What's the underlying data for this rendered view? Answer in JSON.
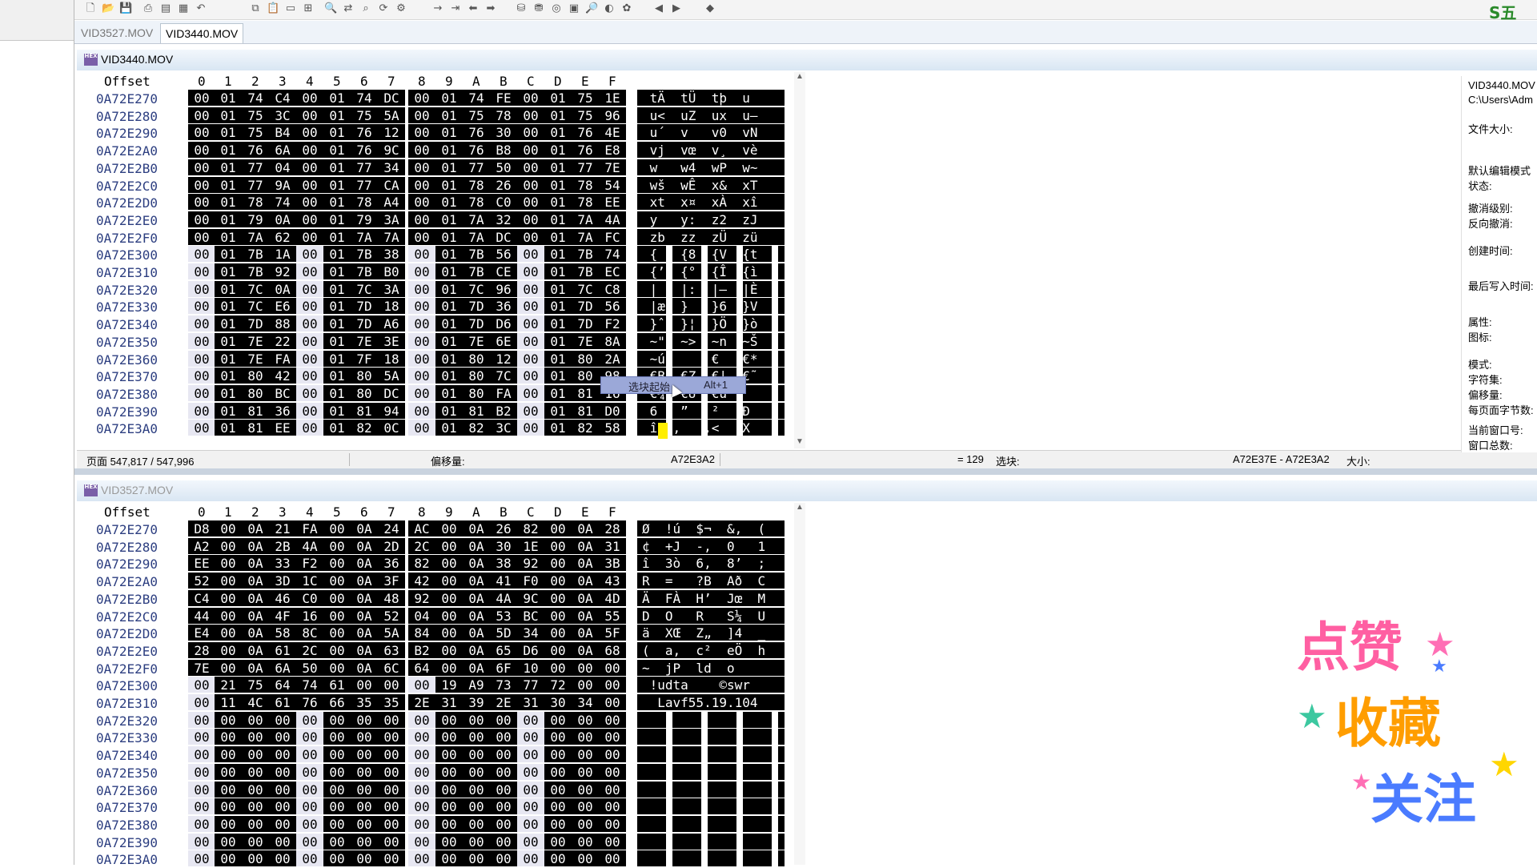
{
  "tabs": [
    "VID3527.MOV",
    "VID3440.MOV"
  ],
  "hex_header": {
    "offset_label": "Offset",
    "columns": [
      "0",
      "1",
      "2",
      "3",
      "4",
      "5",
      "6",
      "7",
      "8",
      "9",
      "A",
      "B",
      "C",
      "D",
      "E",
      "F"
    ]
  },
  "top_pane": {
    "title": "VID3440.MOV",
    "rows": [
      {
        "offset": "0A72E270",
        "bytes": [
          "00",
          "01",
          "74",
          "C4",
          "00",
          "01",
          "74",
          "DC",
          "00",
          "01",
          "74",
          "FE",
          "00",
          "01",
          "75",
          "1E"
        ],
        "ascii": " tÄ  tÜ  tþ  u"
      },
      {
        "offset": "0A72E280",
        "bytes": [
          "00",
          "01",
          "75",
          "3C",
          "00",
          "01",
          "75",
          "5A",
          "00",
          "01",
          "75",
          "78",
          "00",
          "01",
          "75",
          "96"
        ],
        "ascii": " u<  uZ  ux  u–"
      },
      {
        "offset": "0A72E290",
        "bytes": [
          "00",
          "01",
          "75",
          "B4",
          "00",
          "01",
          "76",
          "12",
          "00",
          "01",
          "76",
          "30",
          "00",
          "01",
          "76",
          "4E"
        ],
        "ascii": " u´  v   v0  vN"
      },
      {
        "offset": "0A72E2A0",
        "bytes": [
          "00",
          "01",
          "76",
          "6A",
          "00",
          "01",
          "76",
          "9C",
          "00",
          "01",
          "76",
          "B8",
          "00",
          "01",
          "76",
          "E8"
        ],
        "ascii": " vj  vœ  v¸  vè"
      },
      {
        "offset": "0A72E2B0",
        "bytes": [
          "00",
          "01",
          "77",
          "04",
          "00",
          "01",
          "77",
          "34",
          "00",
          "01",
          "77",
          "50",
          "00",
          "01",
          "77",
          "7E"
        ],
        "ascii": " w   w4  wP  w~"
      },
      {
        "offset": "0A72E2C0",
        "bytes": [
          "00",
          "01",
          "77",
          "9A",
          "00",
          "01",
          "77",
          "CA",
          "00",
          "01",
          "78",
          "26",
          "00",
          "01",
          "78",
          "54"
        ],
        "ascii": " wš  wÊ  x&  xT"
      },
      {
        "offset": "0A72E2D0",
        "bytes": [
          "00",
          "01",
          "78",
          "74",
          "00",
          "01",
          "78",
          "A4",
          "00",
          "01",
          "78",
          "C0",
          "00",
          "01",
          "78",
          "EE"
        ],
        "ascii": " xt  x¤  xÀ  xî"
      },
      {
        "offset": "0A72E2E0",
        "bytes": [
          "00",
          "01",
          "79",
          "0A",
          "00",
          "01",
          "79",
          "3A",
          "00",
          "01",
          "7A",
          "32",
          "00",
          "01",
          "7A",
          "4A"
        ],
        "ascii": " y   y:  z2  zJ"
      },
      {
        "offset": "0A72E2F0",
        "bytes": [
          "00",
          "01",
          "7A",
          "62",
          "00",
          "01",
          "7A",
          "7A",
          "00",
          "01",
          "7A",
          "DC",
          "00",
          "01",
          "7A",
          "FC"
        ],
        "ascii": " zb  zz  zÜ  zü"
      },
      {
        "offset": "0A72E300",
        "bytes": [
          "00",
          "01",
          "7B",
          "1A",
          "00",
          "01",
          "7B",
          "38",
          "00",
          "01",
          "7B",
          "56",
          "00",
          "01",
          "7B",
          "74"
        ],
        "ascii": " {   {8  {V  {t"
      },
      {
        "offset": "0A72E310",
        "bytes": [
          "00",
          "01",
          "7B",
          "92",
          "00",
          "01",
          "7B",
          "B0",
          "00",
          "01",
          "7B",
          "CE",
          "00",
          "01",
          "7B",
          "EC"
        ],
        "ascii": " {’  {°  {Î  {ì"
      },
      {
        "offset": "0A72E320",
        "bytes": [
          "00",
          "01",
          "7C",
          "0A",
          "00",
          "01",
          "7C",
          "3A",
          "00",
          "01",
          "7C",
          "96",
          "00",
          "01",
          "7C",
          "C8"
        ],
        "ascii": " |   |:  |–  |È"
      },
      {
        "offset": "0A72E330",
        "bytes": [
          "00",
          "01",
          "7C",
          "E6",
          "00",
          "01",
          "7D",
          "18",
          "00",
          "01",
          "7D",
          "36",
          "00",
          "01",
          "7D",
          "56"
        ],
        "ascii": " |æ  }   }6  }V"
      },
      {
        "offset": "0A72E340",
        "bytes": [
          "00",
          "01",
          "7D",
          "88",
          "00",
          "01",
          "7D",
          "A6",
          "00",
          "01",
          "7D",
          "D6",
          "00",
          "01",
          "7D",
          "F2"
        ],
        "ascii": " }ˆ  }¦  }Ö  }ò"
      },
      {
        "offset": "0A72E350",
        "bytes": [
          "00",
          "01",
          "7E",
          "22",
          "00",
          "01",
          "7E",
          "3E",
          "00",
          "01",
          "7E",
          "6E",
          "00",
          "01",
          "7E",
          "8A"
        ],
        "ascii": " ~\"  ~>  ~n  ~Š"
      },
      {
        "offset": "0A72E360",
        "bytes": [
          "00",
          "01",
          "7E",
          "FA",
          "00",
          "01",
          "7F",
          "18",
          "00",
          "01",
          "80",
          "12",
          "00",
          "01",
          "80",
          "2A"
        ],
        "ascii": " ~ú      €   €*"
      },
      {
        "offset": "0A72E370",
        "bytes": [
          "00",
          "01",
          "80",
          "42",
          "00",
          "01",
          "80",
          "5A",
          "00",
          "01",
          "80",
          "7C",
          "00",
          "01",
          "80",
          "98"
        ],
        "ascii": " €B  €Z  €|  €˜"
      },
      {
        "offset": "0A72E380",
        "bytes": [
          "00",
          "01",
          "80",
          "BC",
          "00",
          "01",
          "80",
          "DC",
          "00",
          "01",
          "80",
          "FA",
          "00",
          "01",
          "81",
          "16"
        ],
        "ascii": " €¼  €Ü  €ú    "
      },
      {
        "offset": "0A72E390",
        "bytes": [
          "00",
          "01",
          "81",
          "36",
          "00",
          "01",
          "81",
          "94",
          "00",
          "01",
          "81",
          "B2",
          "00",
          "01",
          "81",
          "D0"
        ],
        "ascii": " 6   ”   ²   Ð"
      },
      {
        "offset": "0A72E3A0",
        "bytes": [
          "00",
          "01",
          "81",
          "EE",
          "00",
          "01",
          "82",
          "0C",
          "00",
          "01",
          "82",
          "3C",
          "00",
          "01",
          "82",
          "58"
        ],
        "ascii": " î  ‚   ‚<  ‚X"
      }
    ]
  },
  "status_bar": {
    "page": "页面 547,817 / 547,996",
    "offset_label": "偏移量:",
    "offset_value": "A72E3A2",
    "eq": "= 129",
    "selection_label": "选块:",
    "selection_value": "A72E37E - A72E3A2",
    "size_label": "大小:"
  },
  "context_popup": {
    "label": "选块起始",
    "shortcut": "Alt+1"
  },
  "bottom_pane": {
    "title": "VID3527.MOV",
    "rows": [
      {
        "offset": "0A72E270",
        "bytes": [
          "D8",
          "00",
          "0A",
          "21",
          "FA",
          "00",
          "0A",
          "24",
          "AC",
          "00",
          "0A",
          "26",
          "82",
          "00",
          "0A",
          "28"
        ],
        "ascii": "Ø  !ú  $¬  &‚  ("
      },
      {
        "offset": "0A72E280",
        "bytes": [
          "A2",
          "00",
          "0A",
          "2B",
          "4A",
          "00",
          "0A",
          "2D",
          "2C",
          "00",
          "0A",
          "30",
          "1E",
          "00",
          "0A",
          "31"
        ],
        "ascii": "¢  +J  -,  0   1"
      },
      {
        "offset": "0A72E290",
        "bytes": [
          "EE",
          "00",
          "0A",
          "33",
          "F2",
          "00",
          "0A",
          "36",
          "82",
          "00",
          "0A",
          "38",
          "92",
          "00",
          "0A",
          "3B"
        ],
        "ascii": "î  3ò  6‚  8’  ;"
      },
      {
        "offset": "0A72E2A0",
        "bytes": [
          "52",
          "00",
          "0A",
          "3D",
          "1C",
          "00",
          "0A",
          "3F",
          "42",
          "00",
          "0A",
          "41",
          "F0",
          "00",
          "0A",
          "43"
        ],
        "ascii": "R  =   ?B  Að  C"
      },
      {
        "offset": "0A72E2B0",
        "bytes": [
          "C4",
          "00",
          "0A",
          "46",
          "C0",
          "00",
          "0A",
          "48",
          "92",
          "00",
          "0A",
          "4A",
          "9C",
          "00",
          "0A",
          "4D"
        ],
        "ascii": "Ä  FÀ  H’  Jœ  M"
      },
      {
        "offset": "0A72E2C0",
        "bytes": [
          "44",
          "00",
          "0A",
          "4F",
          "16",
          "00",
          "0A",
          "52",
          "04",
          "00",
          "0A",
          "53",
          "BC",
          "00",
          "0A",
          "55"
        ],
        "ascii": "D  O   R   S¼  U"
      },
      {
        "offset": "0A72E2D0",
        "bytes": [
          "E4",
          "00",
          "0A",
          "58",
          "8C",
          "00",
          "0A",
          "5A",
          "84",
          "00",
          "0A",
          "5D",
          "34",
          "00",
          "0A",
          "5F"
        ],
        "ascii": "ä  XŒ  Z„  ]4  _"
      },
      {
        "offset": "0A72E2E0",
        "bytes": [
          "28",
          "00",
          "0A",
          "61",
          "2C",
          "00",
          "0A",
          "63",
          "B2",
          "00",
          "0A",
          "65",
          "D6",
          "00",
          "0A",
          "68"
        ],
        "ascii": "(  a,  c²  eÖ  h"
      },
      {
        "offset": "0A72E2F0",
        "bytes": [
          "7E",
          "00",
          "0A",
          "6A",
          "50",
          "00",
          "0A",
          "6C",
          "64",
          "00",
          "0A",
          "6F",
          "10",
          "00",
          "00",
          "00"
        ],
        "ascii": "~  jP  ld  o    "
      },
      {
        "offset": "0A72E300",
        "bytes": [
          "00",
          "21",
          "75",
          "64",
          "74",
          "61",
          "00",
          "00",
          "00",
          "19",
          "A9",
          "73",
          "77",
          "72",
          "00",
          "00"
        ],
        "ascii": " !udta    ©swr  "
      },
      {
        "offset": "0A72E310",
        "bytes": [
          "00",
          "11",
          "4C",
          "61",
          "76",
          "66",
          "35",
          "35",
          "2E",
          "31",
          "39",
          "2E",
          "31",
          "30",
          "34",
          "00"
        ],
        "ascii": "  Lavf55.19.104 "
      },
      {
        "offset": "0A72E320",
        "bytes": [
          "00",
          "00",
          "00",
          "00",
          "00",
          "00",
          "00",
          "00",
          "00",
          "00",
          "00",
          "00",
          "00",
          "00",
          "00",
          "00"
        ],
        "ascii": ""
      },
      {
        "offset": "0A72E330",
        "bytes": [
          "00",
          "00",
          "00",
          "00",
          "00",
          "00",
          "00",
          "00",
          "00",
          "00",
          "00",
          "00",
          "00",
          "00",
          "00",
          "00"
        ],
        "ascii": ""
      },
      {
        "offset": "0A72E340",
        "bytes": [
          "00",
          "00",
          "00",
          "00",
          "00",
          "00",
          "00",
          "00",
          "00",
          "00",
          "00",
          "00",
          "00",
          "00",
          "00",
          "00"
        ],
        "ascii": ""
      },
      {
        "offset": "0A72E350",
        "bytes": [
          "00",
          "00",
          "00",
          "00",
          "00",
          "00",
          "00",
          "00",
          "00",
          "00",
          "00",
          "00",
          "00",
          "00",
          "00",
          "00"
        ],
        "ascii": ""
      },
      {
        "offset": "0A72E360",
        "bytes": [
          "00",
          "00",
          "00",
          "00",
          "00",
          "00",
          "00",
          "00",
          "00",
          "00",
          "00",
          "00",
          "00",
          "00",
          "00",
          "00"
        ],
        "ascii": ""
      },
      {
        "offset": "0A72E370",
        "bytes": [
          "00",
          "00",
          "00",
          "00",
          "00",
          "00",
          "00",
          "00",
          "00",
          "00",
          "00",
          "00",
          "00",
          "00",
          "00",
          "00"
        ],
        "ascii": ""
      },
      {
        "offset": "0A72E380",
        "bytes": [
          "00",
          "00",
          "00",
          "00",
          "00",
          "00",
          "00",
          "00",
          "00",
          "00",
          "00",
          "00",
          "00",
          "00",
          "00",
          "00"
        ],
        "ascii": ""
      },
      {
        "offset": "0A72E390",
        "bytes": [
          "00",
          "00",
          "00",
          "00",
          "00",
          "00",
          "00",
          "00",
          "00",
          "00",
          "00",
          "00",
          "00",
          "00",
          "00",
          "00"
        ],
        "ascii": ""
      },
      {
        "offset": "0A72E3A0",
        "bytes": [
          "00",
          "00",
          "00",
          "00",
          "00",
          "00",
          "00",
          "00",
          "00",
          "00",
          "00",
          "00",
          "00",
          "00",
          "00",
          "00"
        ],
        "ascii": ""
      }
    ]
  },
  "info_panel": {
    "filename": "VID3440.MOV",
    "path": "C:\\Users\\Adm",
    "file_size_label": "文件大小:",
    "default_edit_mode": "默认编辑模式",
    "state": "状态:",
    "undo_level": "撤消级别:",
    "redo": "反向撤消:",
    "created": "创建时间:",
    "last_write": "最后写入时间:",
    "attributes": "属性:",
    "icon": "图标:",
    "mode": "模式:",
    "charset": "字符集:",
    "offset": "偏移量:",
    "bytes_per_page": "每页面字节数:",
    "current_window": "当前窗口号:",
    "window_total": "窗口总数:"
  },
  "overlay": {
    "line1": "点赞",
    "line2": "收藏",
    "line3": "关注"
  },
  "icons": [
    "new-file-icon",
    "open-icon",
    "save-icon",
    "print-icon",
    "undo-icon",
    "copy-icon",
    "paste-icon",
    "find-icon",
    "replace-icon",
    "goto-icon",
    "back-icon",
    "forward-icon",
    "disk-icon",
    "ram-icon",
    "calculator-icon",
    "search-icon",
    "properties-icon"
  ],
  "colors": {
    "selection_bg": "#000000",
    "selection_fg": "#ffffff",
    "offset_fg": "#2c3e80",
    "accent_pink": "#ff5fa2",
    "accent_yellow": "#ffd600"
  }
}
